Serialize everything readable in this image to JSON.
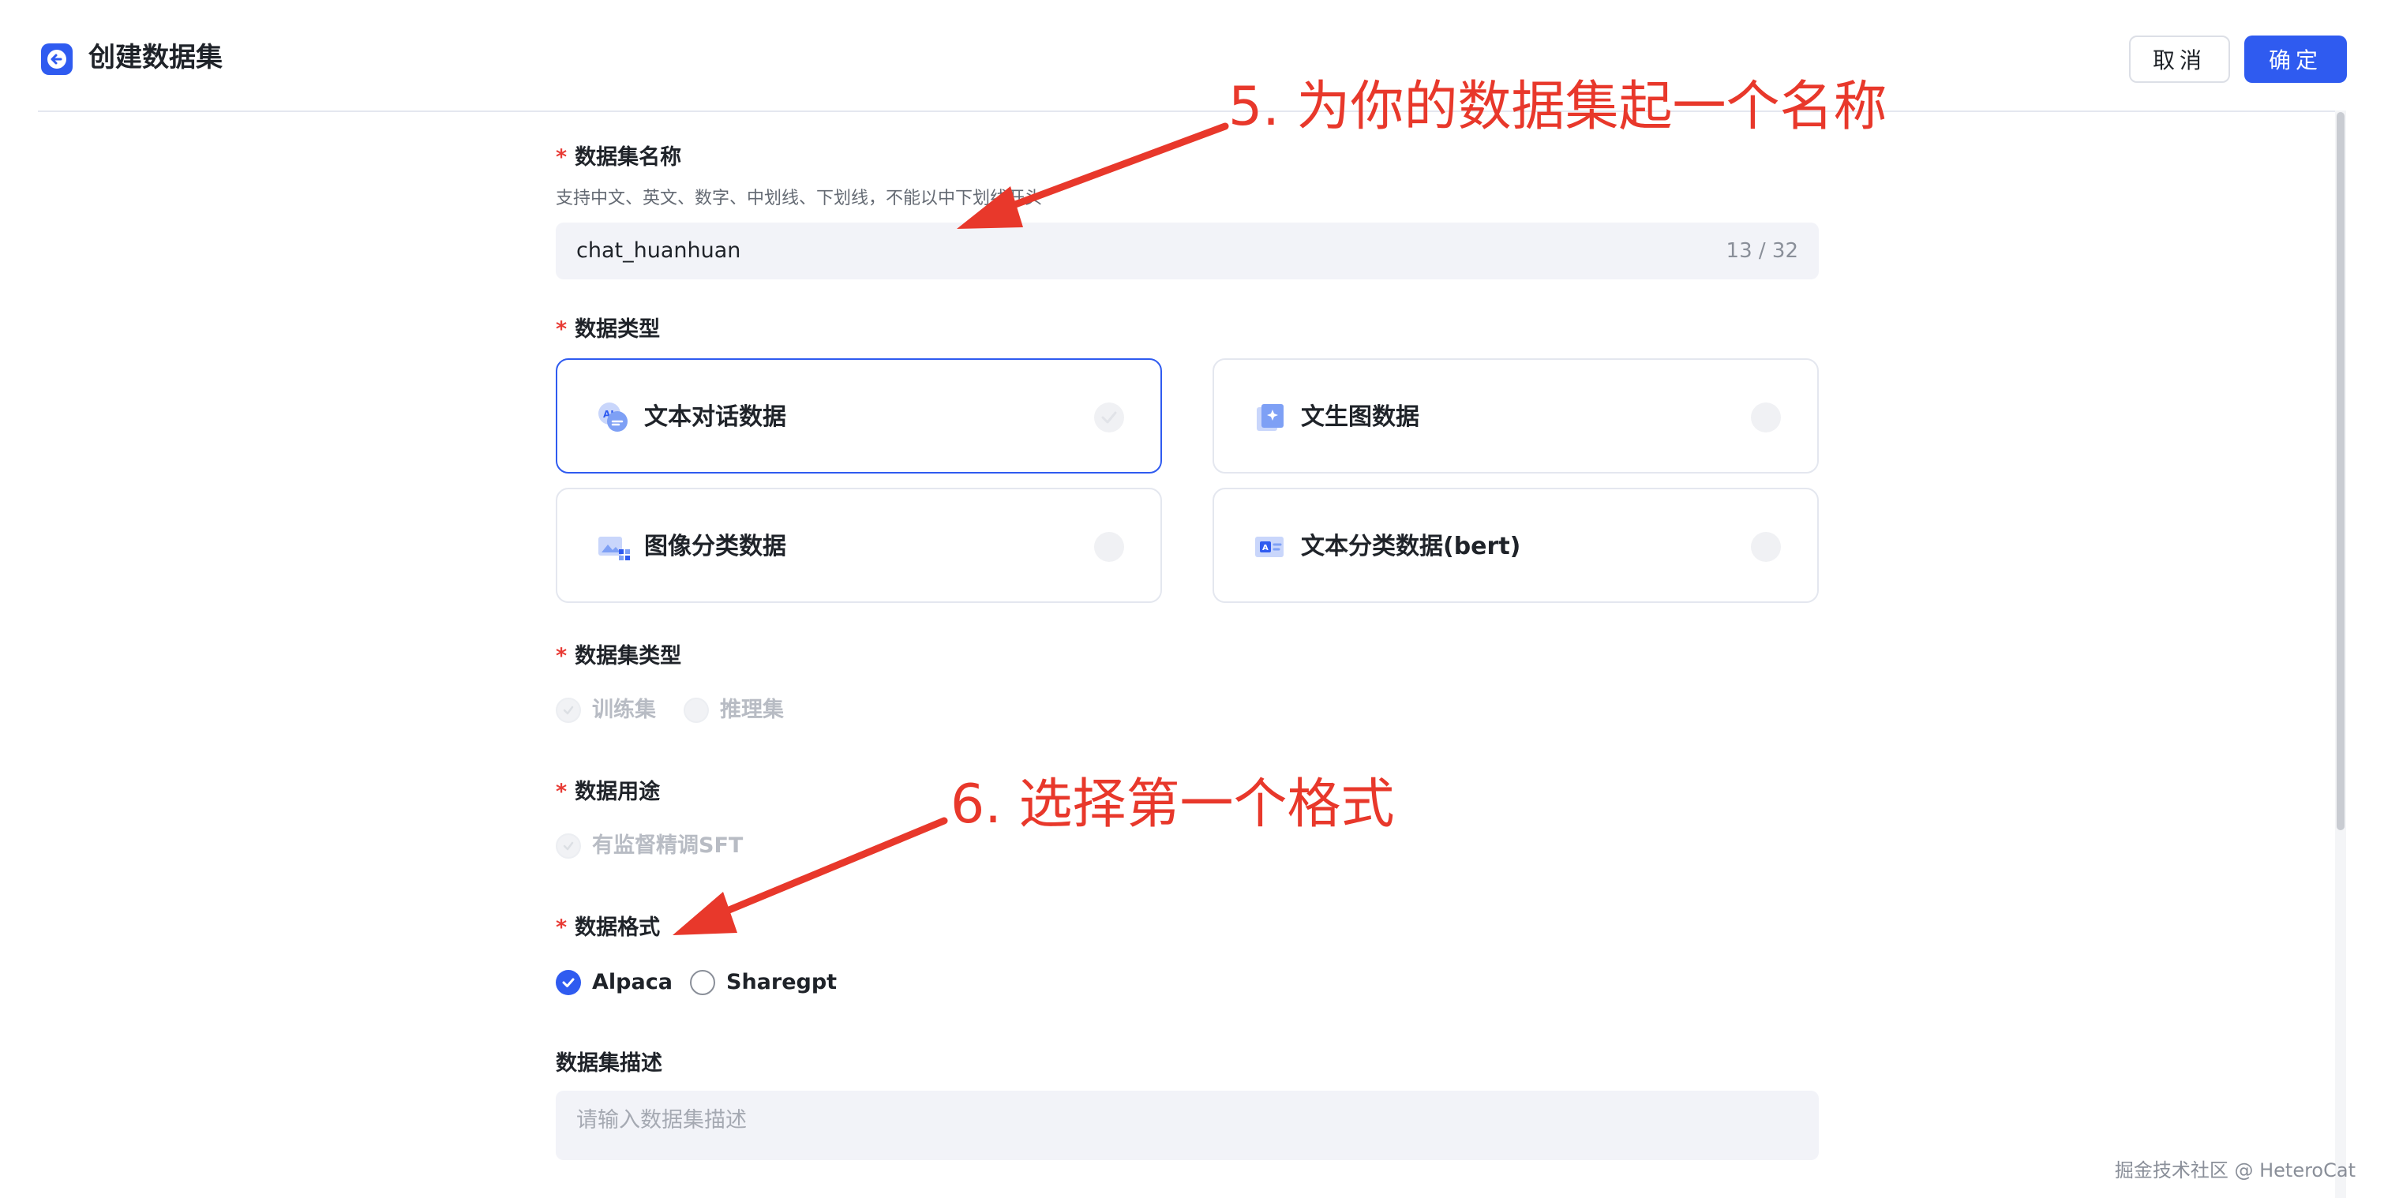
{
  "header": {
    "title": "创建数据集",
    "cancel_label": "取消",
    "confirm_label": "确定"
  },
  "form": {
    "name": {
      "label": "数据集名称",
      "hint": "支持中文、英文、数字、中划线、下划线，不能以中下划线开头",
      "value": "chat_huanhuan",
      "count": "13 / 32"
    },
    "data_type": {
      "label": "数据类型",
      "options": [
        {
          "label": "文本对话数据",
          "icon": "chat-ai-icon",
          "selected": true
        },
        {
          "label": "文生图数据",
          "icon": "text-to-image-icon",
          "selected": false
        },
        {
          "label": "图像分类数据",
          "icon": "image-classify-icon",
          "selected": false
        },
        {
          "label": "文本分类数据(bert)",
          "icon": "text-classify-icon",
          "selected": false
        }
      ]
    },
    "set_type": {
      "label": "数据集类型",
      "options": [
        {
          "label": "训练集",
          "checked": true,
          "disabled": true
        },
        {
          "label": "推理集",
          "checked": false,
          "disabled": true
        }
      ]
    },
    "usage": {
      "label": "数据用途",
      "options": [
        {
          "label": "有监督精调SFT",
          "checked": true,
          "disabled": true
        }
      ]
    },
    "format": {
      "label": "数据格式",
      "options": [
        {
          "label": "Alpaca",
          "checked": true
        },
        {
          "label": "Sharegpt",
          "checked": false
        }
      ]
    },
    "description": {
      "label": "数据集描述",
      "placeholder": "请输入数据集描述"
    },
    "required_mark": "*"
  },
  "annotations": {
    "step5": "5. 为你的数据集起一个名称",
    "step6": "6. 选择第一个格式"
  },
  "watermark": "掘金技术社区 @ HeteroCat",
  "colors": {
    "accent": "#2f5bf0",
    "annotation": "#e8382b",
    "required": "#e83b35"
  }
}
